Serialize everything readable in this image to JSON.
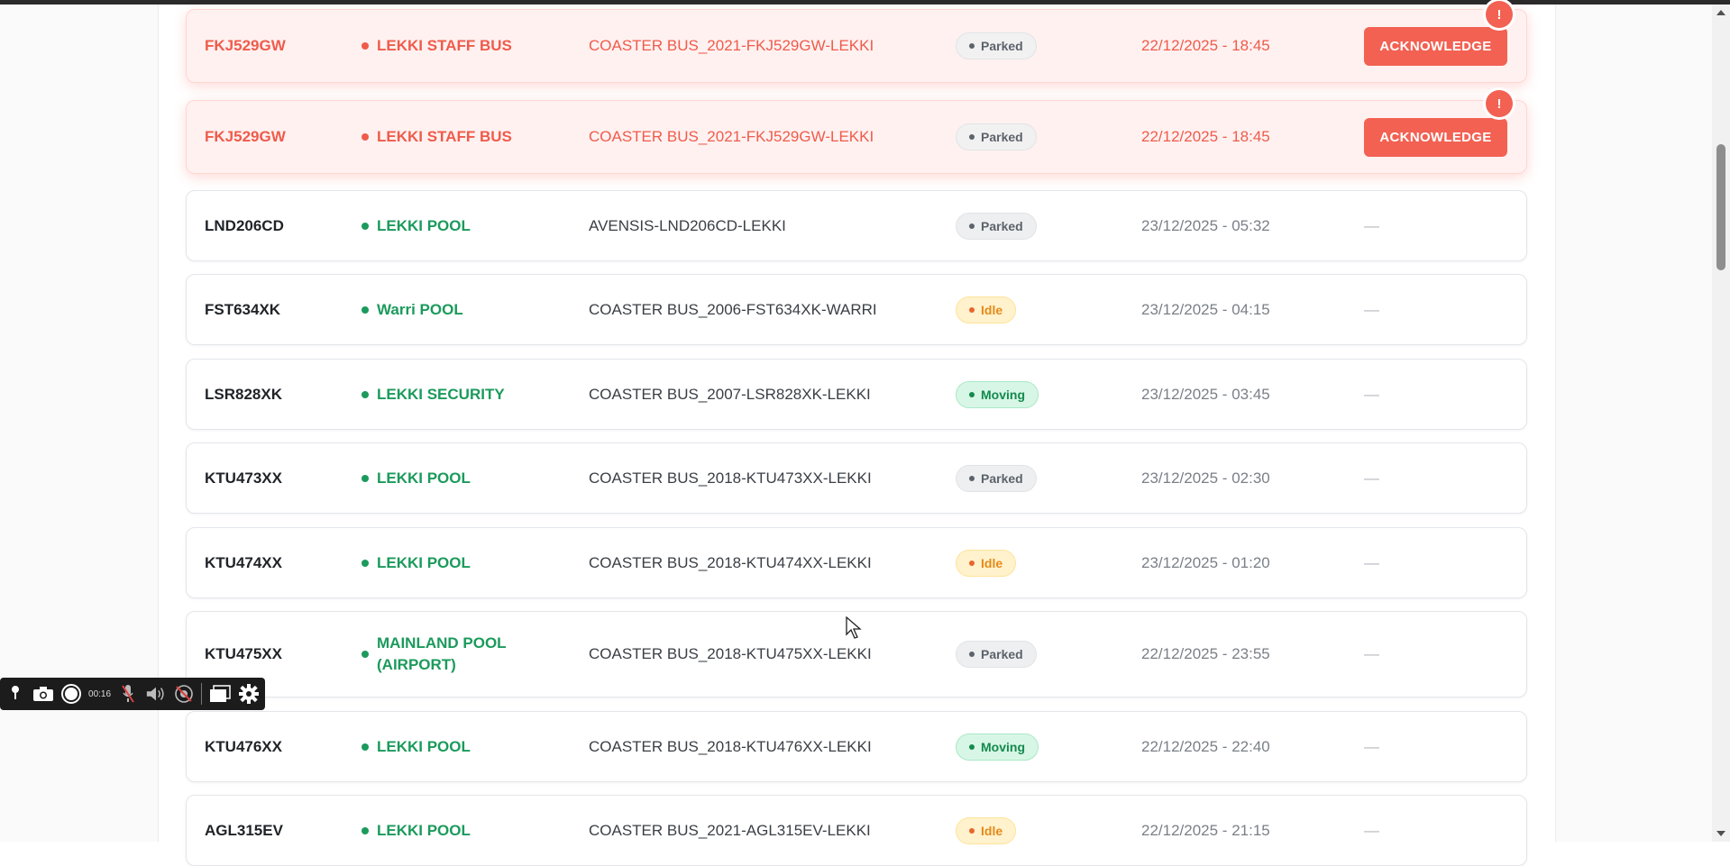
{
  "rows": [
    {
      "plate": "FKJ529GW",
      "pool": "LEKKI STAFF BUS",
      "description": "COASTER BUS_2021-FKJ529GW-LEKKI",
      "status": "Parked",
      "time": "22/12/2025 - 18:45",
      "action": "ACKNOWLEDGE",
      "alert_mark": "!"
    },
    {
      "plate": "FKJ529GW",
      "pool": "LEKKI STAFF BUS",
      "description": "COASTER BUS_2021-FKJ529GW-LEKKI",
      "status": "Parked",
      "time": "22/12/2025 - 18:45",
      "action": "ACKNOWLEDGE",
      "alert_mark": "!"
    },
    {
      "plate": "LND206CD",
      "pool": "LEKKI POOL",
      "description": "AVENSIS-LND206CD-LEKKI",
      "status": "Parked",
      "time": "23/12/2025 - 05:32",
      "action": "—"
    },
    {
      "plate": "FST634XK",
      "pool": "Warri POOL",
      "description": "COASTER BUS_2006-FST634XK-WARRI",
      "status": "Idle",
      "time": "23/12/2025 - 04:15",
      "action": "—"
    },
    {
      "plate": "LSR828XK",
      "pool": "LEKKI SECURITY",
      "description": "COASTER BUS_2007-LSR828XK-LEKKI",
      "status": "Moving",
      "time": "23/12/2025 - 03:45",
      "action": "—"
    },
    {
      "plate": "KTU473XX",
      "pool": "LEKKI POOL",
      "description": "COASTER BUS_2018-KTU473XX-LEKKI",
      "status": "Parked",
      "time": "23/12/2025 - 02:30",
      "action": "—"
    },
    {
      "plate": "KTU474XX",
      "pool": "LEKKI POOL",
      "description": "COASTER BUS_2018-KTU474XX-LEKKI",
      "status": "Idle",
      "time": "23/12/2025 - 01:20",
      "action": "—"
    },
    {
      "plate": "KTU475XX",
      "pool": "MAINLAND POOL (AIRPORT)",
      "description": "COASTER BUS_2018-KTU475XX-LEKKI",
      "status": "Parked",
      "time": "22/12/2025 - 23:55",
      "action": "—"
    },
    {
      "plate": "KTU476XX",
      "pool": "LEKKI POOL",
      "description": "COASTER BUS_2018-KTU476XX-LEKKI",
      "status": "Moving",
      "time": "22/12/2025 - 22:40",
      "action": "—"
    },
    {
      "plate": "AGL315EV",
      "pool": "LEKKI POOL",
      "description": "COASTER BUS_2021-AGL315EV-LEKKI",
      "status": "Idle",
      "time": "22/12/2025 - 21:15",
      "action": "—"
    }
  ],
  "recorder": {
    "elapsed": "00:16"
  },
  "colors": {
    "alert": "#f26152",
    "pool_green": "#1b9a5c",
    "idle": "#e58a1a",
    "moving": "#148a4e"
  }
}
